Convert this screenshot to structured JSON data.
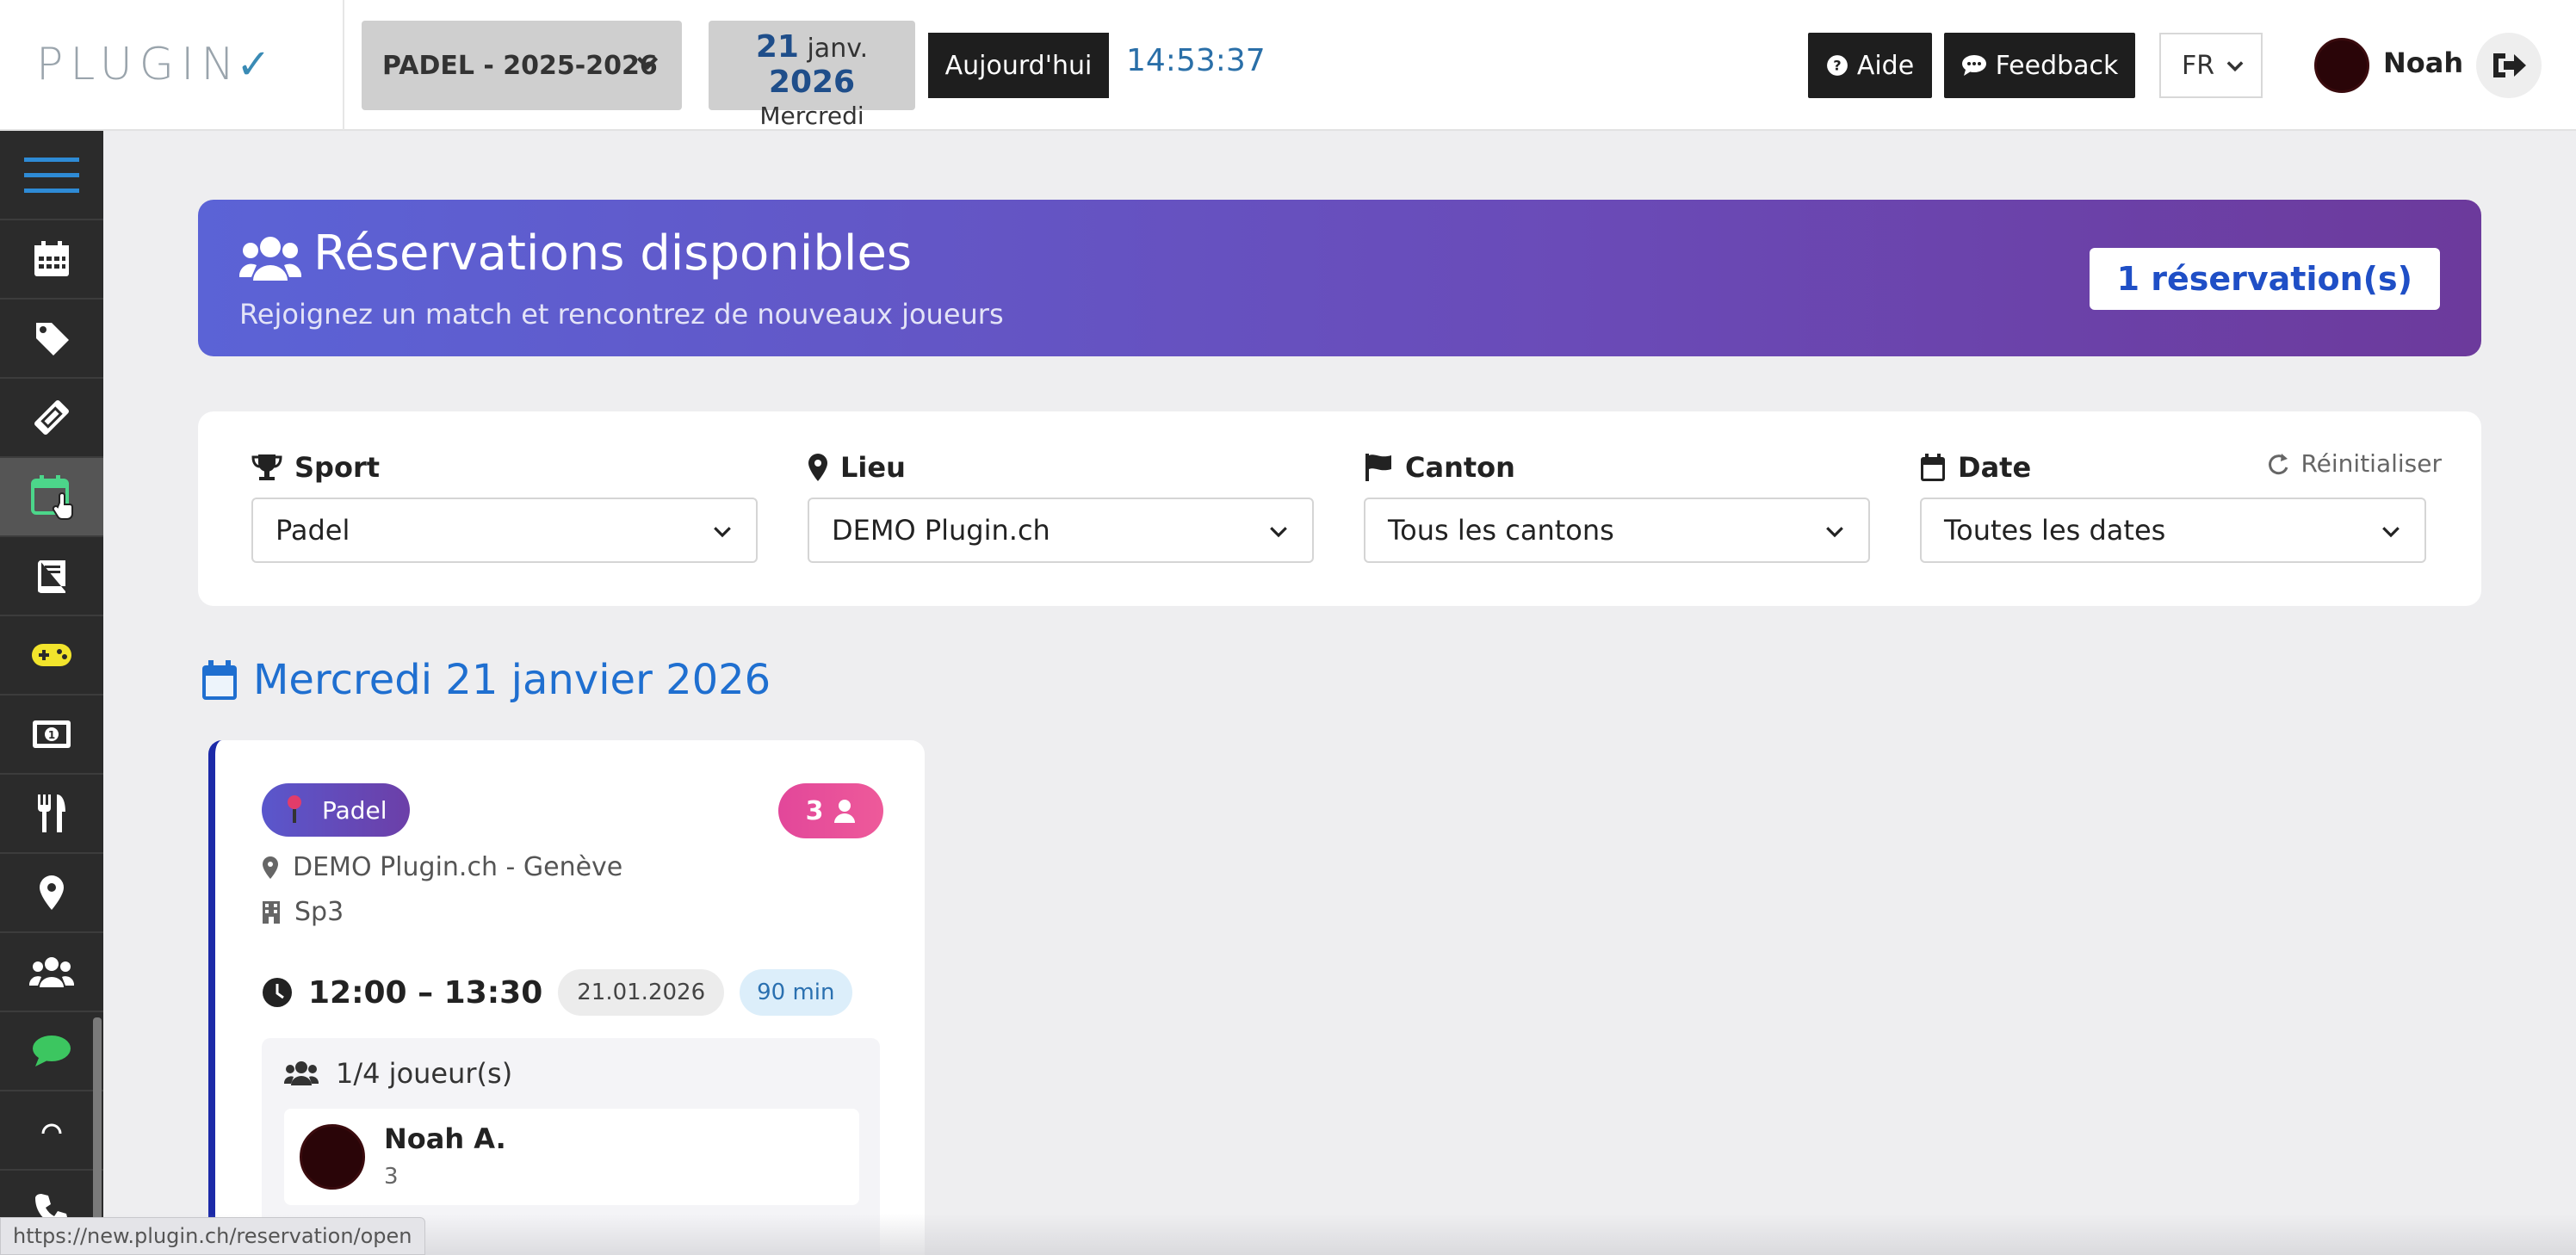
{
  "header": {
    "logo_text": "PLUGIN",
    "season": "PADEL - 2025-2026",
    "date_day": "21",
    "date_month": "janv.",
    "date_year": "2026",
    "date_weekday": "Mercredi",
    "today_label": "Aujourd'hui",
    "clock": "14:53:37",
    "help_label": "Aide",
    "feedback_label": "Feedback",
    "language": "FR",
    "user_name": "Noah"
  },
  "sidebar": {
    "items": [
      {
        "icon": "menu-icon"
      },
      {
        "icon": "calendar-icon"
      },
      {
        "icon": "tag-icon"
      },
      {
        "icon": "ticket-icon"
      },
      {
        "icon": "calendar-plus-icon",
        "active": true
      },
      {
        "icon": "book-icon"
      },
      {
        "icon": "gamepad-icon"
      },
      {
        "icon": "money-icon"
      },
      {
        "icon": "utensils-icon"
      },
      {
        "icon": "map-marker-icon"
      },
      {
        "icon": "users-icon"
      },
      {
        "icon": "chat-icon"
      },
      {
        "icon": "spinner-icon"
      },
      {
        "icon": "phone-icon"
      }
    ]
  },
  "banner": {
    "title": "Réservations disponibles",
    "subtitle": "Rejoignez un match et rencontrez de nouveaux joueurs",
    "badge": "1 réservation(s)"
  },
  "filters": {
    "sport": {
      "label": "Sport",
      "value": "Padel"
    },
    "lieu": {
      "label": "Lieu",
      "value": "DEMO Plugin.ch"
    },
    "canton": {
      "label": "Canton",
      "value": "Tous les cantons"
    },
    "date": {
      "label": "Date",
      "value": "Toutes les dates"
    },
    "reset_label": "Réinitialiser"
  },
  "day_heading": "Mercredi 21 janvier 2026",
  "reservation": {
    "sport": "Padel",
    "count": "3",
    "location": "DEMO Plugin.ch - Genève",
    "court": "Sp3",
    "time": "12:00 – 13:30",
    "date": "21.01.2026",
    "duration": "90 min",
    "players_label": "1/4 joueur(s)",
    "player": {
      "name": "Noah A.",
      "level": "3"
    }
  },
  "status_url": "https://new.plugin.ch/reservation/open",
  "colors": {
    "accent": "#1f6fd0",
    "banner_start": "#5b63d6",
    "banner_end": "#6c3a9c",
    "pink": "#e2479a",
    "sidebar": "#2b2b2b"
  }
}
